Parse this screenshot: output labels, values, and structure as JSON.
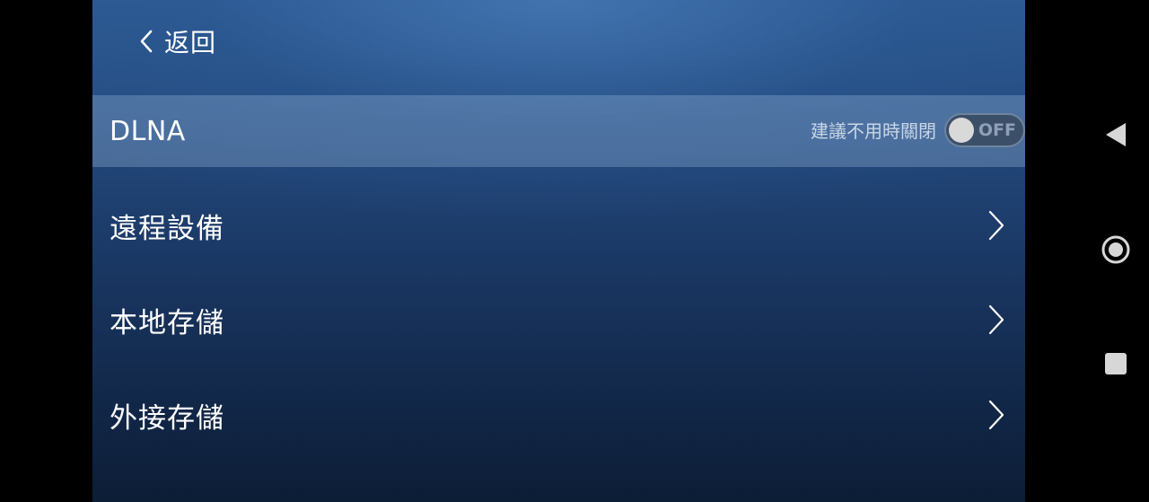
{
  "header": {
    "back_label": "返回",
    "back_icon": "chevron-left-icon"
  },
  "dlna": {
    "label": "DLNA",
    "hint": "建議不用時關閉",
    "toggle_state": "OFF",
    "enabled": false
  },
  "menu": {
    "items": [
      {
        "label": "遠程設備",
        "icon": "chevron-right-icon"
      },
      {
        "label": "本地存儲",
        "icon": "chevron-right-icon"
      },
      {
        "label": "外接存儲",
        "icon": "chevron-right-icon"
      }
    ]
  },
  "system_nav": {
    "back_icon": "triangle-back-icon",
    "home_icon": "circle-home-icon",
    "recents_icon": "square-recents-icon"
  },
  "colors": {
    "background_top": "#2d5a92",
    "background_bottom": "#0c1d36",
    "highlight_row": "#5a7fa9",
    "text": "#ffffff"
  }
}
